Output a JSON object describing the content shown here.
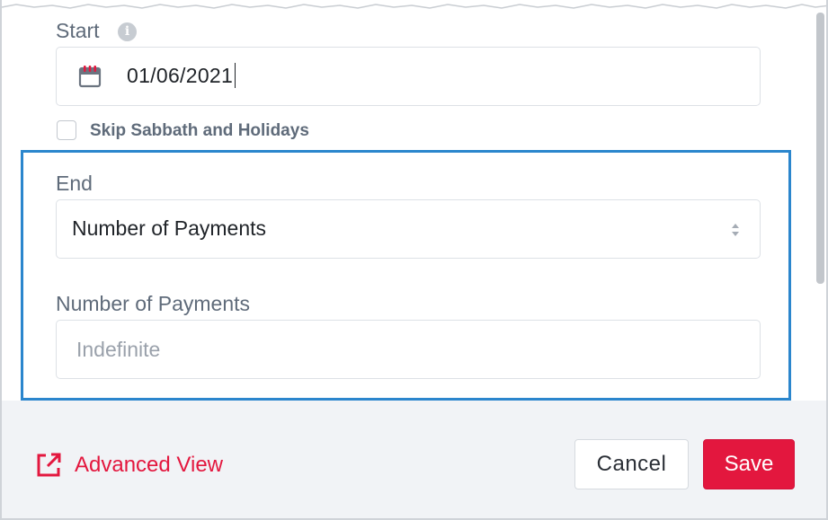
{
  "start": {
    "label": "Start",
    "info_icon": "info-icon",
    "date_value": "01/06/2021",
    "calendar_icon": "calendar-icon"
  },
  "skip": {
    "label": "Skip Sabbath and Holidays",
    "checked": false
  },
  "end": {
    "label": "End",
    "selected": "Number of Payments"
  },
  "payments": {
    "label": "Number of Payments",
    "placeholder": "Indefinite"
  },
  "footer": {
    "advanced_view_label": "Advanced View",
    "cancel_label": "Cancel",
    "save_label": "Save"
  },
  "colors": {
    "accent": "#e3173e",
    "highlight": "#2b86cd",
    "label_text": "#5f6b7a",
    "footer_bg": "#f1f3f6"
  }
}
